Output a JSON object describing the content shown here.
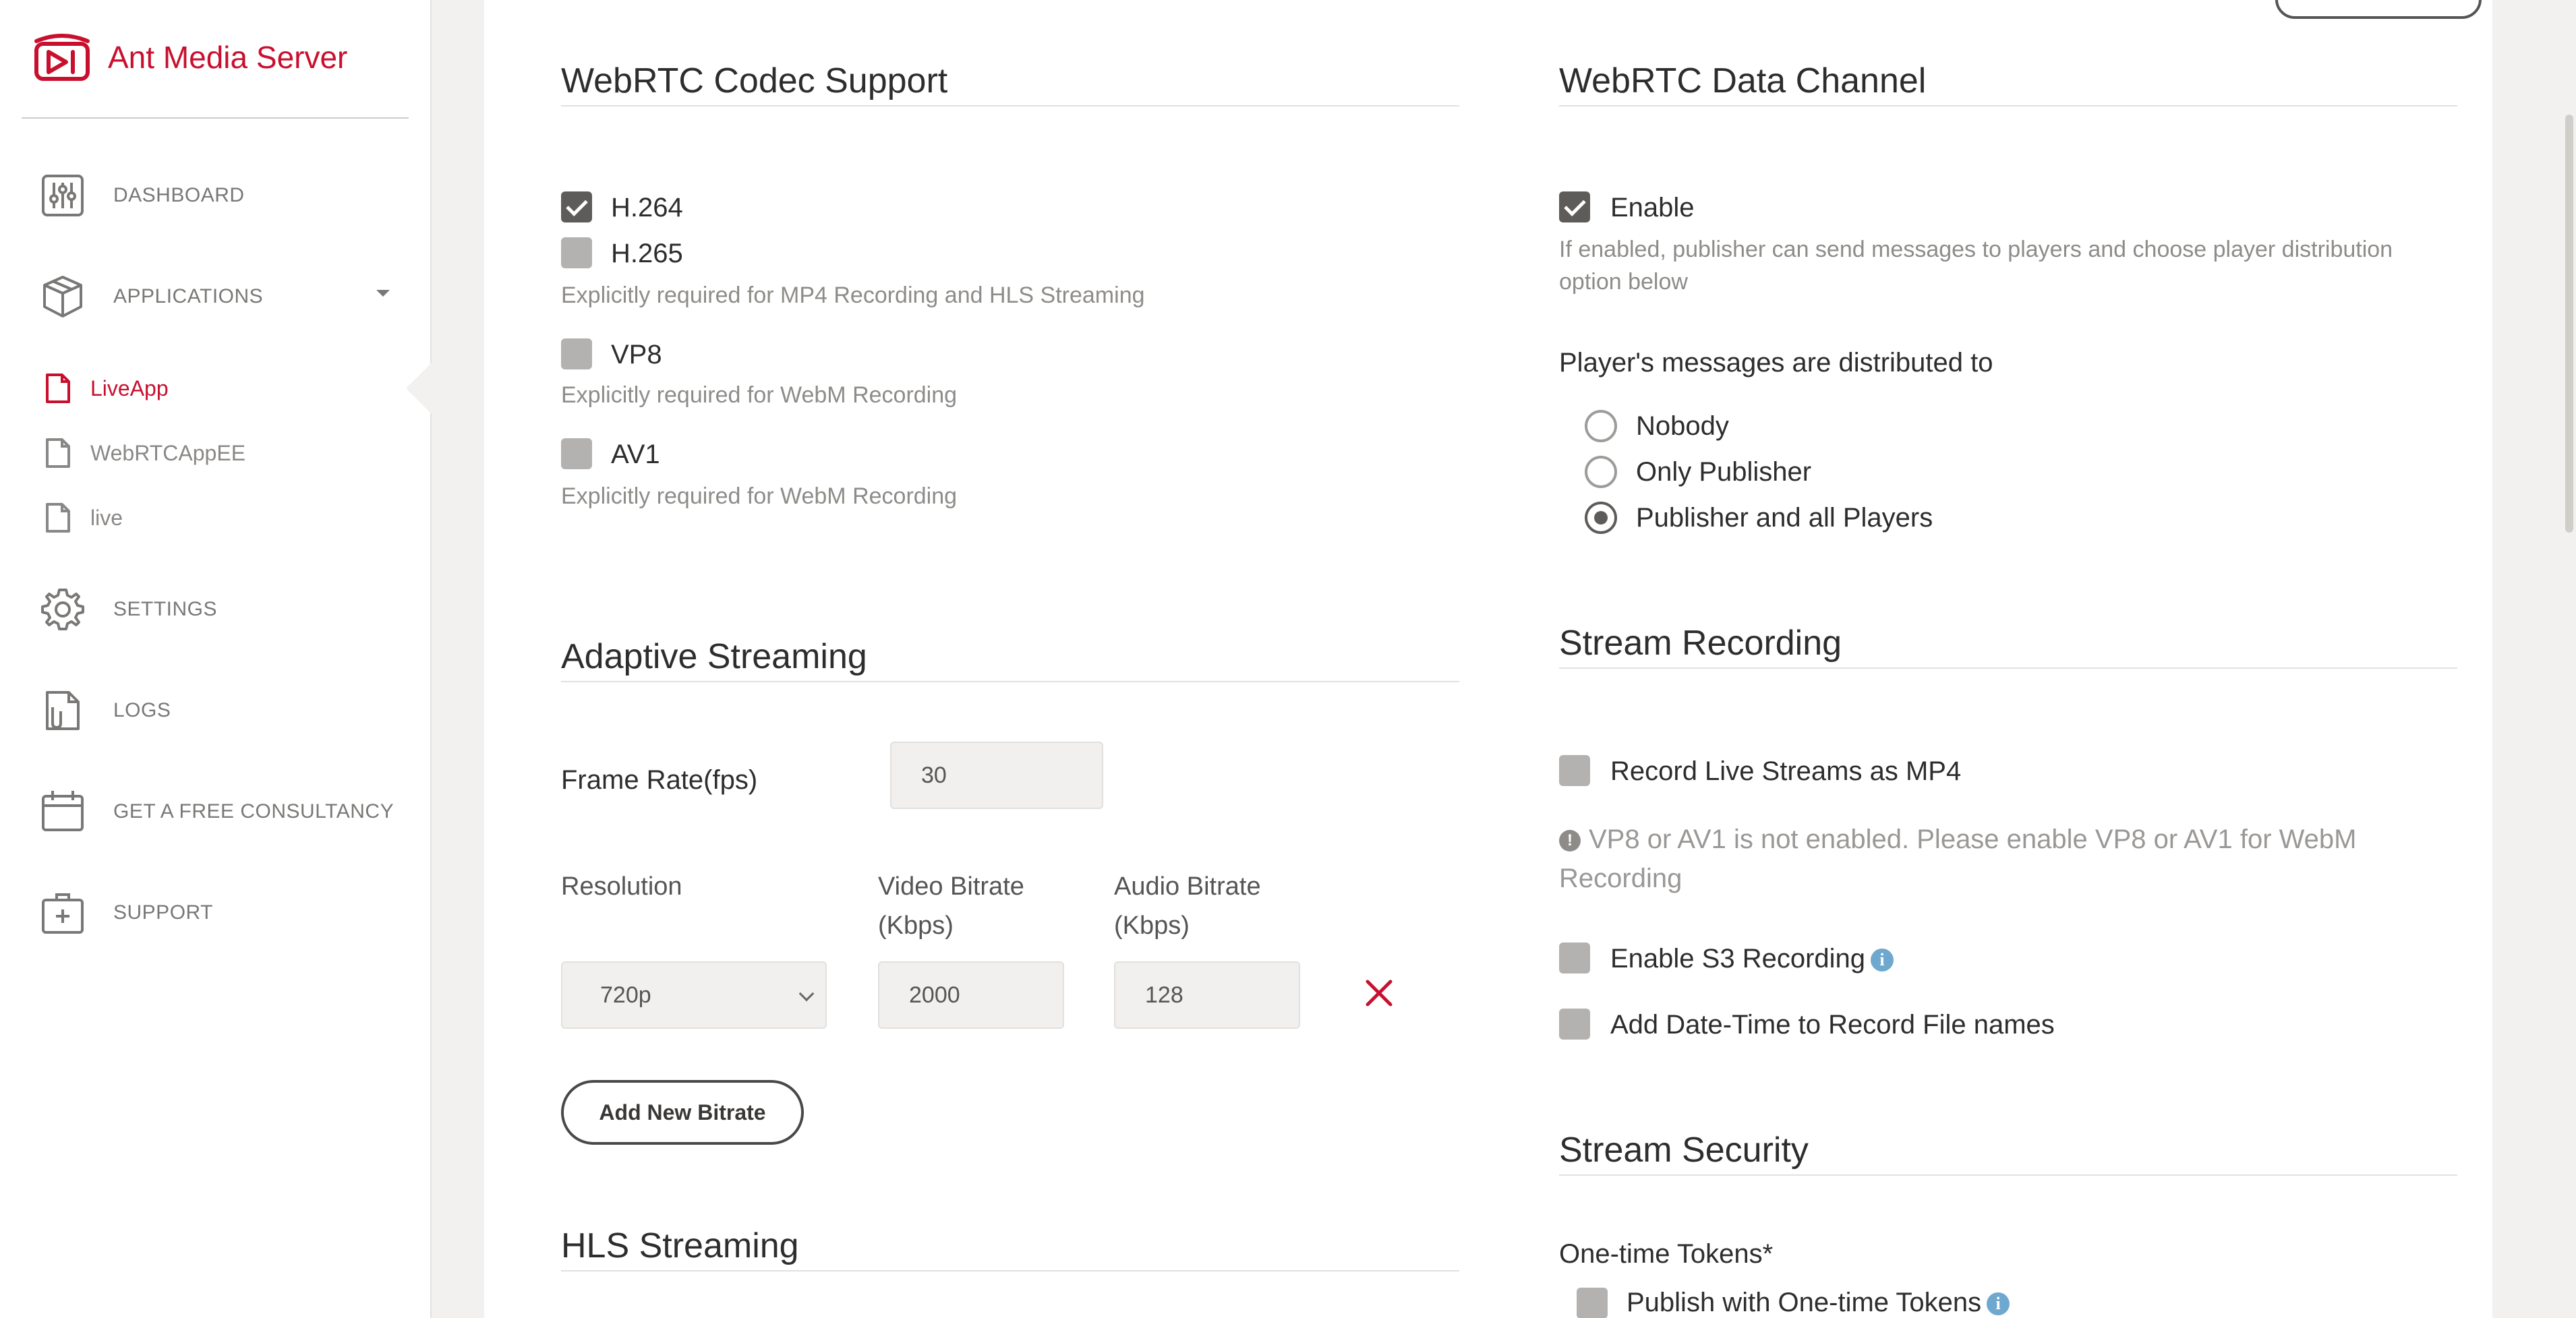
{
  "brand": {
    "name": "Ant Media Server"
  },
  "sidebar": {
    "nav": [
      {
        "label": "DASHBOARD",
        "icon": "sliders-icon"
      },
      {
        "label": "APPLICATIONS",
        "icon": "box-icon"
      },
      {
        "label": "SETTINGS",
        "icon": "gear-icon"
      },
      {
        "label": "LOGS",
        "icon": "logs-icon"
      },
      {
        "label": "GET A FREE CONSULTANCY",
        "icon": "calendar-icon"
      },
      {
        "label": "SUPPORT",
        "icon": "medkit-icon"
      }
    ],
    "apps": [
      {
        "label": "LiveApp",
        "active": true
      },
      {
        "label": "WebRTCAppEE",
        "active": false
      },
      {
        "label": "live",
        "active": false
      }
    ]
  },
  "codec": {
    "title": "WebRTC Codec Support",
    "h264": {
      "label": "H.264",
      "checked": true
    },
    "h265": {
      "label": "H.265",
      "checked": false,
      "hint": "Explicitly required for MP4 Recording and HLS Streaming"
    },
    "vp8": {
      "label": "VP8",
      "checked": false,
      "hint": "Explicitly required for WebM Recording"
    },
    "av1": {
      "label": "AV1",
      "checked": false,
      "hint": "Explicitly required for WebM Recording"
    }
  },
  "adaptive": {
    "title": "Adaptive Streaming",
    "frame_rate_label": "Frame Rate(fps)",
    "frame_rate_value": "30",
    "col_resolution": "Resolution",
    "col_video_line1": "Video Bitrate",
    "col_video_line2": "(Kbps)",
    "col_audio_line1": "Audio Bitrate",
    "col_audio_line2": "(Kbps)",
    "row": {
      "resolution": "720p",
      "video_bitrate": "2000",
      "audio_bitrate": "128"
    },
    "add_button": "Add New Bitrate"
  },
  "hls": {
    "title": "HLS Streaming"
  },
  "datachannel": {
    "title": "WebRTC Data Channel",
    "enable_label": "Enable",
    "enable_checked": true,
    "hint_line1": "If enabled, publisher can send messages to players and choose player distribution",
    "hint_line2": "option below",
    "dist_label": "Player's messages are distributed to",
    "options": [
      {
        "label": "Nobody",
        "selected": false
      },
      {
        "label": "Only Publisher",
        "selected": false
      },
      {
        "label": "Publisher and all Players",
        "selected": true
      }
    ]
  },
  "recording": {
    "title": "Stream Recording",
    "mp4_label": "Record Live Streams as MP4",
    "warning_line1": "VP8 or AV1 is not enabled. Please enable VP8 or AV1 for WebM",
    "warning_line2": "Recording",
    "s3_label": "Enable S3 Recording",
    "datetime_label": "Add Date-Time to Record File names"
  },
  "security": {
    "title": "Stream Security",
    "tokens_label": "One-time Tokens*",
    "publish_tokens_label": "Publish with One-time Tokens"
  },
  "colors": {
    "brand_red": "#c8102e",
    "checkbox_checked": "#5e5c59",
    "checkbox_unchecked": "#b3b2b0",
    "info_blue": "#6fa8cf"
  }
}
